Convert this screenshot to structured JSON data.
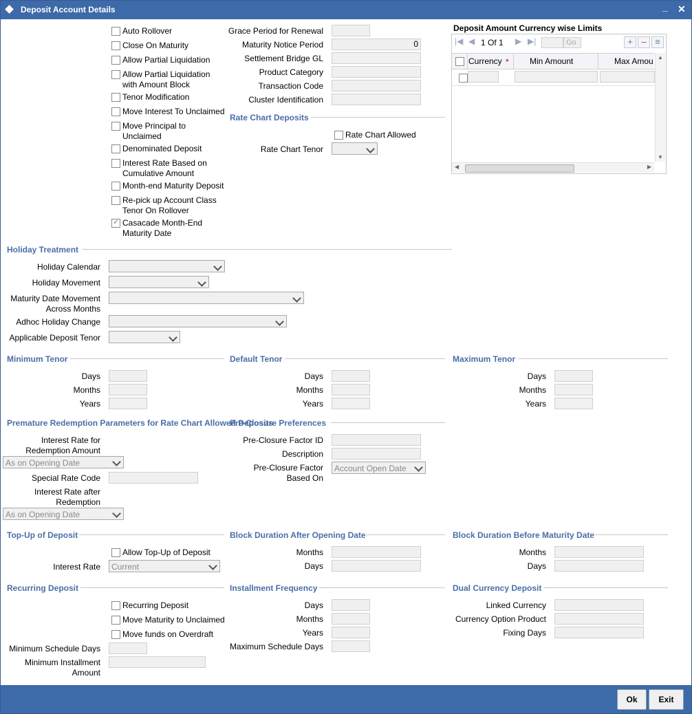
{
  "window": {
    "title": "Deposit Account Details",
    "minimize_label": "_",
    "close_label": "✕"
  },
  "options": {
    "auto_rollover": "Auto Rollover",
    "close_on_maturity": "Close On Maturity",
    "allow_partial_liquidation": "Allow Partial Liquidation",
    "allow_partial_liq_block_1": "Allow Partial Liquidation",
    "allow_partial_liq_block_2": "with Amount Block",
    "tenor_modification": "Tenor Modification",
    "move_interest_unclaimed": "Move Interest To Unclaimed",
    "move_principal_1": "Move Principal to",
    "move_principal_2": "Unclaimed",
    "denominated_deposit": "Denominated Deposit",
    "interest_rate_cum_1": "Interest Rate Based on",
    "interest_rate_cum_2": "Cumulative Amount",
    "month_end_maturity": "Month-end Maturity Deposit",
    "repick_1": "Re-pick up Account Class",
    "repick_2": "Tenor On Rollover",
    "casacade_1": "Casacade Month-End",
    "casacade_2": "Maturity Date"
  },
  "middle": {
    "grace_period": "Grace Period for Renewal",
    "maturity_notice": "Maturity Notice Period",
    "maturity_notice_value": "0",
    "settlement_gl": "Settlement Bridge GL",
    "product_category": "Product Category",
    "transaction_code": "Transaction Code",
    "cluster_id": "Cluster Identification",
    "rate_chart_section": "Rate Chart Deposits",
    "rate_chart_allowed": "Rate Chart Allowed",
    "rate_chart_tenor": "Rate Chart Tenor"
  },
  "limits": {
    "title": "Deposit Amount Currency wise Limits",
    "page": "1 Of 1",
    "go": "Go",
    "col_currency": "Currency",
    "required_mark": "*",
    "col_min": "Min Amount",
    "col_max": "Max Amou"
  },
  "holiday": {
    "section": "Holiday Treatment",
    "calendar": "Holiday Calendar",
    "movement": "Holiday Movement",
    "maturity_move_1": "Maturity Date Movement",
    "maturity_move_2": "Across Months",
    "adhoc": "Adhoc Holiday Change",
    "applicable_tenor": "Applicable Deposit Tenor"
  },
  "tenor": {
    "min_section": "Minimum Tenor",
    "default_section": "Default Tenor",
    "max_section": "Maximum Tenor",
    "days": "Days",
    "months": "Months",
    "years": "Years"
  },
  "premature": {
    "section": "Premature Redemption Parameters for Rate Chart Allowed Deposits",
    "rate_redemption_1": "Interest Rate for",
    "rate_redemption_2": "Redemption Amount",
    "as_on_opening": "As on Opening Date",
    "special_rate": "Special Rate Code",
    "rate_after_1": "Interest Rate after",
    "rate_after_2": "Redemption",
    "as_on_opening_2": "As on Opening Date"
  },
  "preclosure": {
    "section": "Pre-Closure Preferences",
    "factor_id": "Pre-Closure Factor ID",
    "description": "Description",
    "based_on_1": "Pre-Closure Factor",
    "based_on_2": "Based On",
    "based_on_value": "Account Open Date"
  },
  "topup": {
    "section": "Top-Up of Deposit",
    "allow": "Allow Top-Up of Deposit",
    "interest_rate": "Interest Rate",
    "interest_rate_value": "Current"
  },
  "block_after": {
    "section": "Block Duration After Opening Date",
    "months": "Months",
    "days": "Days"
  },
  "block_before": {
    "section": "Block Duration Before Maturity Date",
    "months": "Months",
    "days": "Days"
  },
  "recurring": {
    "section": "Recurring Deposit",
    "recurring": "Recurring Deposit",
    "move_maturity": "Move Maturity to Unclaimed",
    "move_funds": "Move funds on Overdraft",
    "min_schedule": "Minimum Schedule Days",
    "min_installment_1": "Minimum Installment",
    "min_installment_2": "Amount"
  },
  "installment": {
    "section": "Installment Frequency",
    "days": "Days",
    "months": "Months",
    "years": "Years",
    "max_schedule": "Maximum Schedule Days"
  },
  "dual": {
    "section": "Dual Currency Deposit",
    "linked": "Linked Currency",
    "option_product": "Currency Option Product",
    "fixing": "Fixing Days"
  },
  "footer": {
    "ok": "Ok",
    "exit": "Exit"
  }
}
